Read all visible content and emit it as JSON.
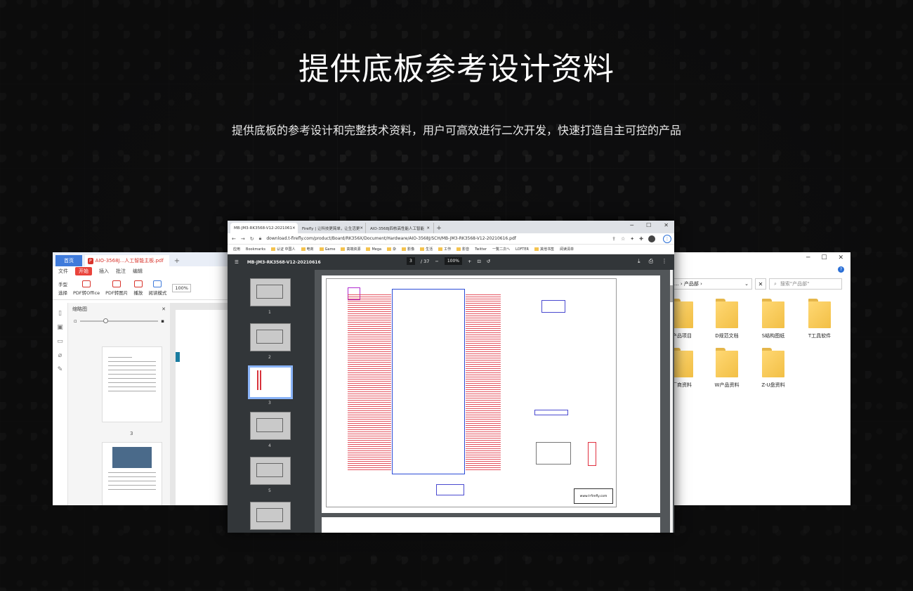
{
  "hero": {
    "title": "提供底板参考设计资料",
    "subtitle": "提供底板的参考设计和完整技术资料，用户可高效进行二次开发，快速打造自主可控的产品"
  },
  "left_window": {
    "tab_home": "首页",
    "tab_file": "AIO-3568J...人工智能主板.pdf",
    "tab_add": "+",
    "menu": [
      "文件",
      "开始",
      "插入",
      "批注",
      "编辑"
    ],
    "tools": {
      "hand": "手型",
      "select": "选择",
      "pdf_to_office": "PDF转Office",
      "pdf_to_image": "PDF转图片",
      "play": "播放",
      "read_mode": "阅读模式",
      "zoom": "100%"
    },
    "thumbnail_panel_title": "缩略图",
    "page_number": "3"
  },
  "center_window": {
    "tabs": [
      {
        "label": "MB-JM3-RK3568-V12-2021061"
      },
      {
        "label": "Firefly | 让科技更简单，让生活更"
      },
      {
        "label": "AIO-3568J四核高性能人工智能"
      }
    ],
    "url": "download.t-firefly.com/product/Board/RK356X/Document/Hardware/AIO-3568J/SCH/MB-JM3-RK3568-V12-20210616.pdf",
    "bookmarks": [
      "应用",
      "Bookmarks",
      "认证 中国人",
      "电商",
      "Game",
      "高端资源",
      "Mega",
      "杂",
      "影像",
      "生活",
      "工作",
      "影音",
      "Twitter",
      "一覧二次へ",
      "LOFTER",
      "其他书签",
      "阅读清单"
    ],
    "pdf": {
      "title": "MB-JM3-RK3568-V12-20210616",
      "page_current": "3",
      "page_total": "/ 37",
      "zoom": "100%",
      "thumbnail_numbers": [
        "1",
        "2",
        "3",
        "4",
        "5"
      ],
      "logo_text": "www.t-firefly.com"
    }
  },
  "right_window": {
    "address": "... › 产品部 ›",
    "search_placeholder": "搜索\"产品部\"",
    "folders": [
      "产品项目",
      "D规范文档",
      "S结构图纸",
      "T工具软件",
      "厂商资料",
      "W产品资料",
      "Z-U盘资料"
    ]
  },
  "colors": {
    "background": "#0d0d0e",
    "accent_blue": "#3f7bdb",
    "pdf_red": "#d8332b",
    "folder_yellow": "#f2bf45"
  }
}
